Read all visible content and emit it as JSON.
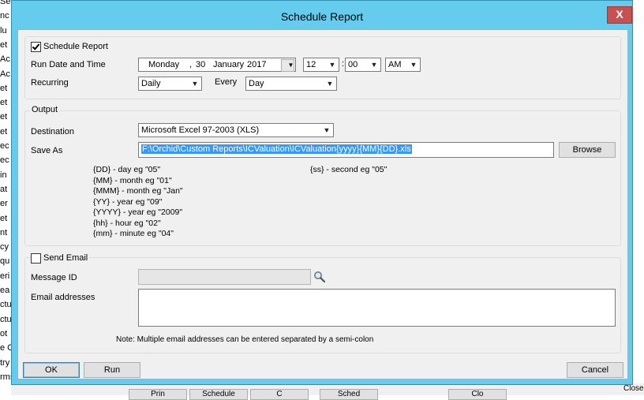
{
  "background": {
    "left_fragments": [
      "Se",
      "nc",
      "lu",
      "et",
      "Ac",
      "Ac",
      "et",
      "et",
      "et",
      "et",
      "ec",
      "ec",
      "in",
      "at",
      "er",
      "et",
      "nt",
      "cy",
      "qu",
      "eri",
      "ea",
      "ctu",
      "ctu",
      "ot",
      "e C",
      "try",
      "rms"
    ],
    "bottom_buttons": [
      "Prin",
      "Schedule",
      "C",
      "Sched",
      "Clo"
    ],
    "close_label": "Close"
  },
  "dialog": {
    "title": "Schedule Report",
    "close_glyph": "X",
    "schedule": {
      "checkbox_label": "Schedule Report",
      "checked": true,
      "run_label": "Run Date and Time",
      "date": {
        "weekday": "Monday",
        "sep": ",",
        "day": "30",
        "month": "January",
        "year": "2017"
      },
      "hour": "12",
      "time_sep": ":",
      "minute": "00",
      "ampm": "AM",
      "recurring_label": "Recurring",
      "recurring_value": "Daily",
      "every_label": "Every",
      "every_value": "Day"
    },
    "output": {
      "legend": "Output",
      "destination_label": "Destination",
      "destination_value": "Microsoft Excel 97-2003 (XLS)",
      "save_as_label": "Save As",
      "save_as_value": "F:\\Orchid\\Custom Reports\\ICValuation\\ICValuation{yyyy}{MM}{DD}.xls",
      "browse_label": "Browse",
      "hints_left": [
        "{DD} - day eg \"05\"",
        "{MM} - month eg \"01\"",
        "{MMM} - month eg \"Jan\"",
        "{YY} - year eg \"09\"",
        "{YYYY} - year eg \"2009\"",
        "{hh} - hour eg \"02\"",
        "{mm} - minute eg \"04\""
      ],
      "hints_right": [
        "{ss} - second eg \"05\""
      ]
    },
    "email": {
      "checkbox_label": "Send Email",
      "checked": false,
      "message_id_label": "Message ID",
      "message_id_value": "",
      "addresses_label": "Email addresses",
      "addresses_value": "",
      "note": "Note: Multiple email addresses can be entered separated by a semi-colon"
    },
    "buttons": {
      "ok": "OK",
      "run": "Run",
      "cancel": "Cancel"
    }
  }
}
